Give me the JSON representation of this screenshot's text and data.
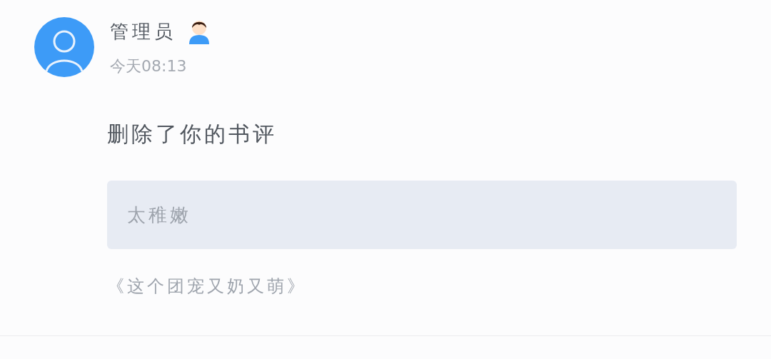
{
  "notification": {
    "sender": "管理员",
    "is_admin": true,
    "time": "今天08:13",
    "message": "删除了你的书评",
    "quoted_review": "太稚嫩",
    "book_title": "《这个团宠又奶又萌》"
  }
}
